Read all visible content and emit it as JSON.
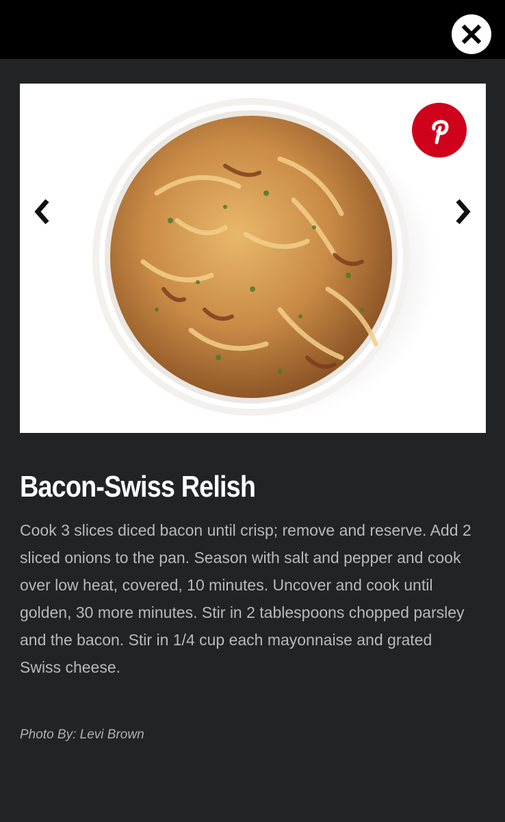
{
  "header": {
    "close_icon": "close-icon"
  },
  "slide": {
    "image_icon": "food-photo-bowl",
    "pinterest_icon": "pinterest-icon",
    "prev_icon": "chevron-left-icon",
    "next_icon": "chevron-right-icon",
    "pinterest_color": "#d0021b"
  },
  "recipe": {
    "title": "Bacon-Swiss Relish",
    "description": "Cook 3 slices diced bacon until crisp; remove and reserve. Add 2 sliced onions to the pan. Season with salt and pepper and cook over low heat, covered, 10 minutes. Uncover and cook until golden, 30 more minutes. Stir in 2 tablespoons chopped parsley and the bacon. Stir in 1/4 cup each mayonnaise and grated Swiss cheese.",
    "photo_credit": "Photo By: Levi Brown"
  },
  "colors": {
    "background": "#222325",
    "topbar": "#000000",
    "title": "#ffffff",
    "body_text": "#b9b9b9"
  }
}
